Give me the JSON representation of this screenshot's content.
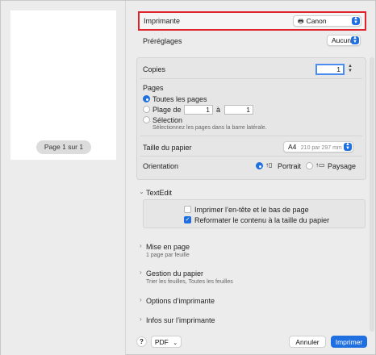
{
  "preview": {
    "page_indicator": "Page 1 sur 1"
  },
  "printer": {
    "label": "Imprimante",
    "value": "Canon"
  },
  "presets": {
    "label": "Préréglages",
    "value": "Aucun"
  },
  "copies": {
    "label": "Copies",
    "value": "1"
  },
  "pages": {
    "label": "Pages",
    "all_label": "Toutes les pages",
    "range_label": "Plage de",
    "range_from": "1",
    "range_to_label": "à",
    "range_to": "1",
    "selection_label": "Sélection",
    "selection_hint": "Sélectionnez les pages dans la barre latérale."
  },
  "paper_size": {
    "label": "Taille du papier",
    "value": "A4",
    "detail": "210 par 297 mm"
  },
  "orientation": {
    "label": "Orientation",
    "portrait": "Portrait",
    "landscape": "Paysage"
  },
  "textedit": {
    "title": "TextEdit",
    "print_header_footer": "Imprimer l’en-tête et le bas de page",
    "rewrap_contents": "Reformater le contenu à la taille du papier"
  },
  "sections": [
    {
      "title": "Mise en page",
      "subtitle": "1 page par feuille"
    },
    {
      "title": "Gestion du papier",
      "subtitle": "Trier les feuilles, Toutes les feuilles"
    },
    {
      "title": "Options d’imprimante",
      "subtitle": ""
    },
    {
      "title": "Infos sur l’imprimante",
      "subtitle": ""
    }
  ],
  "footer": {
    "help": "?",
    "pdf": "PDF",
    "cancel": "Annuler",
    "print": "Imprimer"
  },
  "colors": {
    "accent": "#1f6fe0",
    "highlight_border": "#e0222a"
  }
}
